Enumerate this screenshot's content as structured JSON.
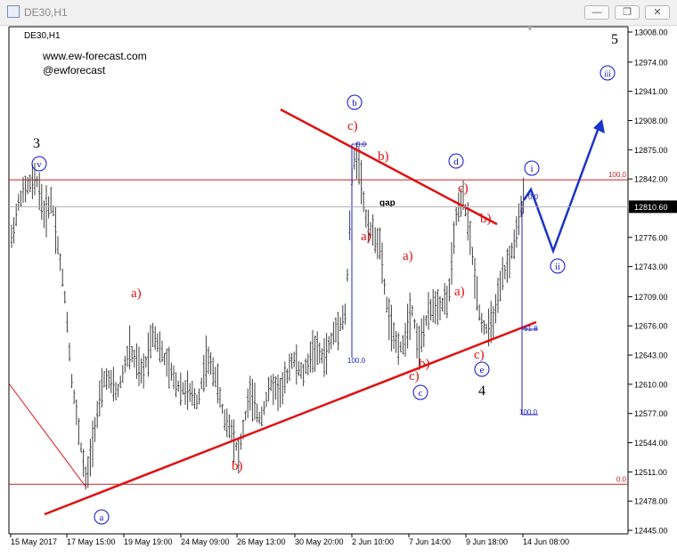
{
  "window": {
    "title": "DE30,H1",
    "min_glyph": "—",
    "max_glyph": "❐",
    "close_glyph": "✕"
  },
  "chart_info": {
    "symbol_label": "DE30,H1",
    "website": "www.ew-forecast.com",
    "handle": "@ewforecast",
    "gap_label": "gap"
  },
  "colors": {
    "price_bars": "#404040",
    "wave_red": "#e01010",
    "wave_blue": "#1010cc",
    "forecast_arrow": "#1a33c8",
    "hline_red": "#cc2020",
    "current_price_line": "#b0b0b0",
    "fib_blue": "#2020cc"
  },
  "chart_data": {
    "type": "candlestick",
    "y_axis": {
      "ticks": [
        "13008.00",
        "12974.00",
        "12941.00",
        "12908.00",
        "12875.00",
        "12842.00",
        "12776.00",
        "12743.00",
        "12709.00",
        "12676.00",
        "12643.00",
        "12610.00",
        "12577.00",
        "12544.00",
        "12511.00",
        "12478.00",
        "12445.00"
      ],
      "current_price": "12810.60",
      "range": [
        12445,
        13008
      ]
    },
    "x_axis": {
      "ticks": [
        "15 May 2017",
        "17 May 15:00",
        "19 May 19:00",
        "24 May 09:00",
        "26 May 13:00",
        "30 May 20:00",
        "2 Jun 10:00",
        "7 Jun 14:00",
        "9 Jun 18:00",
        "14 Jun 08:00"
      ]
    },
    "horizontal_levels": [
      {
        "value": 12841,
        "label": "100.0"
      },
      {
        "value": 12497,
        "label": "0.0"
      }
    ],
    "fib_labels": [
      "0.0",
      "100.0",
      "0.0",
      "61.8",
      "100.0"
    ],
    "wave_labels_black": [
      "3",
      "4",
      "5"
    ],
    "wave_labels_circled": [
      "v",
      "a",
      "b",
      "c",
      "d",
      "e",
      "i",
      "ii",
      "iii"
    ],
    "wave_labels_red": [
      "a)",
      "b)",
      "c)",
      "b)",
      "a)",
      "a)",
      "b)",
      "c)",
      "c)",
      "a)",
      "b)",
      "c)"
    ]
  }
}
